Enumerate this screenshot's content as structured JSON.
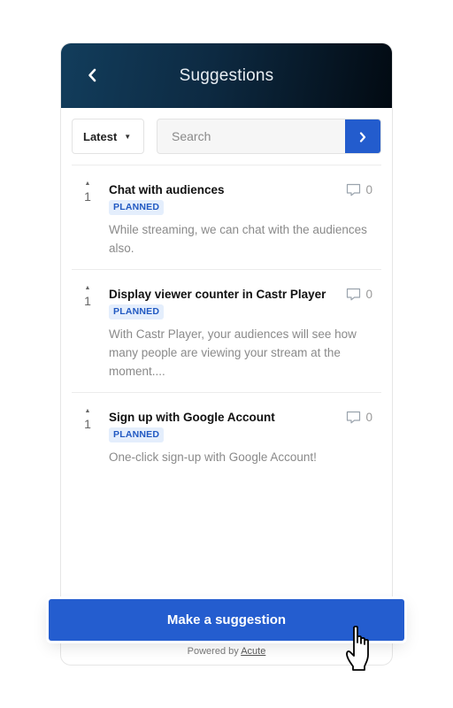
{
  "header": {
    "title": "Suggestions",
    "back_icon": "chevron-left-icon"
  },
  "controls": {
    "sort_selected": "Latest",
    "search_placeholder": "Search",
    "search_value": "",
    "submit_icon": "chevron-right-icon"
  },
  "suggestions": [
    {
      "title": "Chat with audiences",
      "status": "PLANNED",
      "description": "While streaming, we can chat with the audiences also.",
      "votes": "1",
      "comments": "0"
    },
    {
      "title": "Display viewer counter in Castr Player",
      "status": "PLANNED",
      "description": "With Castr Player, your audiences will see how many people are viewing your stream at the moment....",
      "votes": "1",
      "comments": "0"
    },
    {
      "title": "Sign up with Google Account",
      "status": "PLANNED",
      "description": "One-click sign-up with Google Account!",
      "votes": "1",
      "comments": "0"
    }
  ],
  "footer": {
    "cta_label": "Make a suggestion",
    "powered_prefix": "Powered by",
    "powered_link": "Acute"
  },
  "colors": {
    "accent": "#245dcf",
    "badge_bg": "#e4eefc",
    "badge_text": "#2159c2",
    "header_dark": "#020a12",
    "header_light": "#123d5c"
  }
}
